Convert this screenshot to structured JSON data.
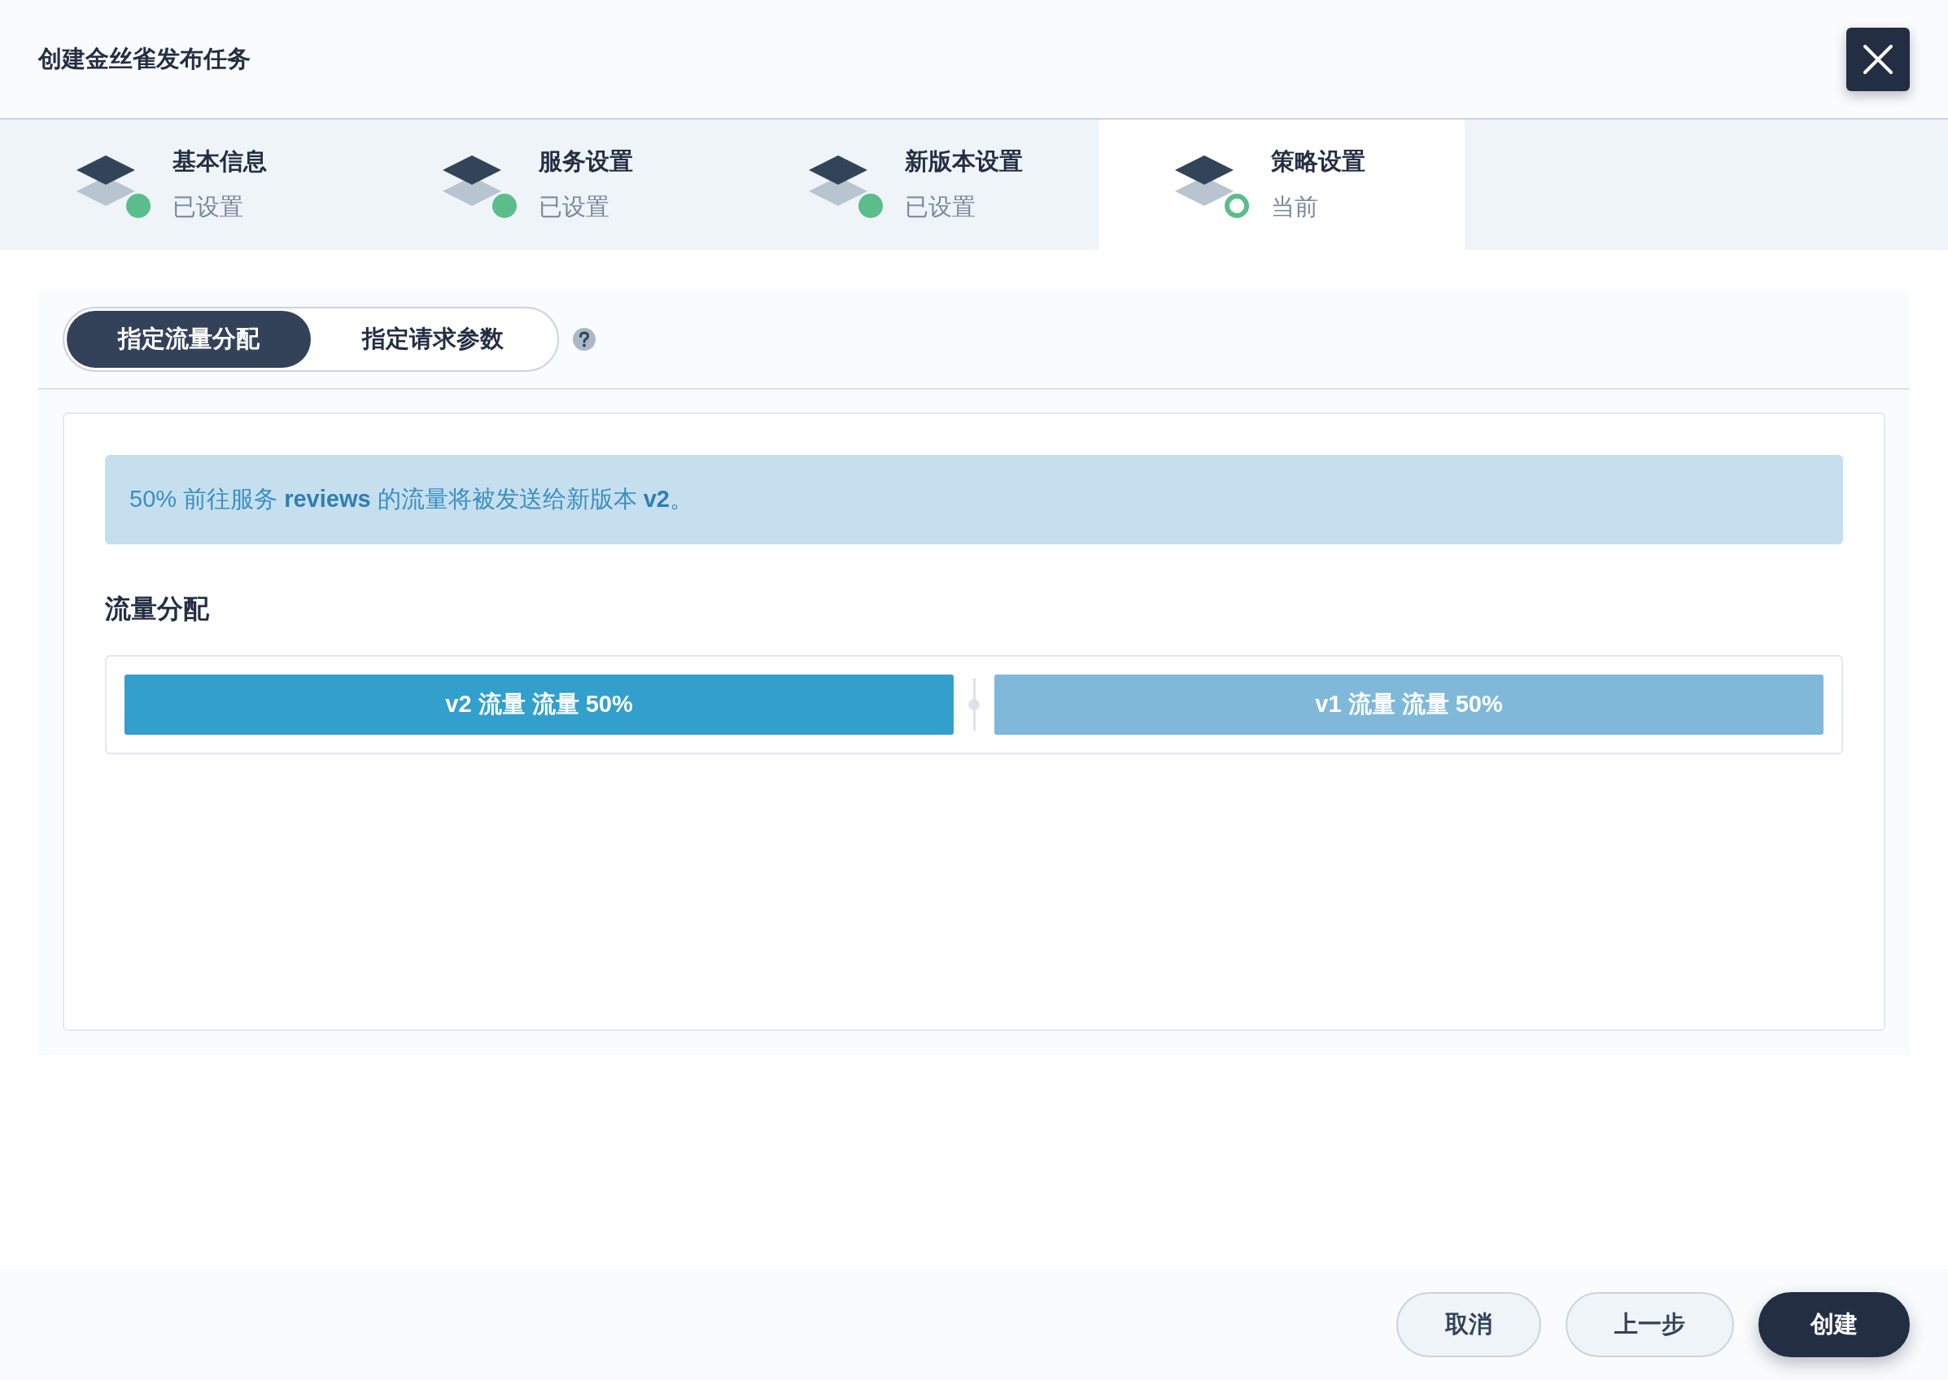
{
  "dialog": {
    "title": "创建金丝雀发布任务"
  },
  "steps": [
    {
      "title": "基本信息",
      "status": "已设置",
      "kind": "done",
      "selected": false
    },
    {
      "title": "服务设置",
      "status": "已设置",
      "kind": "done",
      "selected": false
    },
    {
      "title": "新版本设置",
      "status": "已设置",
      "kind": "done",
      "selected": false
    },
    {
      "title": "策略设置",
      "status": "当前",
      "kind": "current",
      "selected": true
    }
  ],
  "mode_tabs": [
    {
      "label": "指定流量分配",
      "selected": true
    },
    {
      "label": "指定请求参数",
      "selected": false
    }
  ],
  "info_banner": "50% 前往服务 **reviews** 的流量将被发送给新版本 **v2**。",
  "traffic": {
    "title": "流量分配",
    "level": 0.5,
    "segments": [
      {
        "label": "v2 流量 流量 50%",
        "color": "#329fcd"
      },
      {
        "label": "v1 流量 流量 50%",
        "color": "#7fb8d9"
      }
    ]
  },
  "footer_buttons": [
    {
      "label": "取消",
      "kind": "secondary"
    },
    {
      "label": "上一步",
      "kind": "secondary"
    },
    {
      "label": "创建",
      "kind": "primary"
    }
  ]
}
